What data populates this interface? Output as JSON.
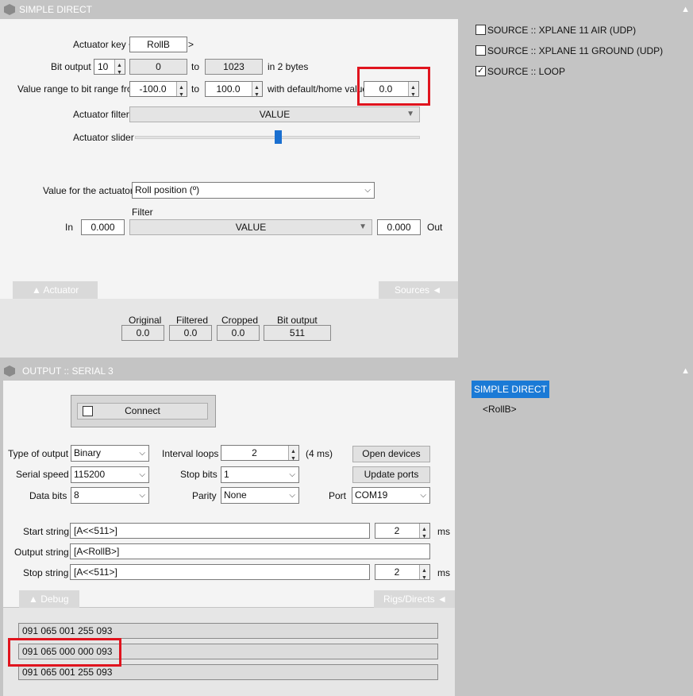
{
  "top_window": {
    "title": "SIMPLE DIRECT",
    "actuator_key_label": "Actuator key <",
    "actuator_key_value": "RollB",
    "actuator_key_suffix": ">",
    "bit_output_label": "Bit output",
    "bit_output_value": "10",
    "bit_min": "0",
    "to_1": "to",
    "bit_max": "1023",
    "bytes_label": "in 2 bytes",
    "range_label": "Value range to bit range from",
    "range_from": "-100.0",
    "to_2": "to",
    "range_to": "100.0",
    "default_label": "with default/home value",
    "default_value": "0.0",
    "filter_label": "Actuator filter",
    "filter_value": "VALUE",
    "slider_label": "Actuator slider",
    "slider_level": 0.5,
    "value_for_actuator_label": "Value for the actuator",
    "value_for_actuator": "Roll position (º)",
    "filter_title": "Filter",
    "in_label": "In",
    "in_value": "0.000",
    "filter2_value": "VALUE",
    "out_value": "0.000",
    "out_label": "Out",
    "tab_actuator": "▲  Actuator",
    "tab_sources": "Sources  ◄",
    "readouts": [
      {
        "label": "Original",
        "value": "0.0"
      },
      {
        "label": "Filtered",
        "value": "0.0"
      },
      {
        "label": "Cropped",
        "value": "0.0"
      },
      {
        "label": "Bit output",
        "value": "511"
      }
    ]
  },
  "sources": [
    {
      "label": "SOURCE :: XPLANE 11 AIR (UDP)",
      "checked": false
    },
    {
      "label": "SOURCE :: XPLANE 11 GROUND (UDP)",
      "checked": false
    },
    {
      "label": "SOURCE :: LOOP",
      "checked": true
    }
  ],
  "bottom_window": {
    "title": "OUTPUT :: SERIAL 3",
    "connect_label": "Connect",
    "type_label": "Type of output",
    "type_value": "Binary",
    "speed_label": "Serial speed",
    "speed_value": "115200",
    "databits_label": "Data bits",
    "databits_value": "8",
    "interval_label": "Interval loops",
    "interval_value": "2",
    "interval_ms": "(4 ms)",
    "stopbits_label": "Stop bits",
    "stopbits_value": "1",
    "parity_label": "Parity",
    "parity_value": "None",
    "port_label": "Port",
    "port_value": "COM19",
    "open_devices": "Open devices",
    "update_ports": "Update ports",
    "start_label": "Start string",
    "start_value": "[A<<511>]",
    "start_ms_value": "2",
    "ms_1": "ms",
    "output_label": "Output string",
    "output_value": "[A<RollB>]",
    "stop_label": "Stop string",
    "stop_value": "[A<<511>]",
    "stop_ms_value": "2",
    "ms_2": "ms",
    "tab_debug": "▲  Debug",
    "tab_rigs": "Rigs/Directs  ◄",
    "debug_lines": [
      "091 065 001 255 093",
      "091 065 000 000 093",
      "091 065 001 255 093"
    ]
  },
  "right_list": {
    "selected": "SIMPLE DIRECT",
    "child": "<RollB>"
  },
  "colors": {
    "highlight": "#e0141e",
    "selection": "#1a7ad6"
  }
}
